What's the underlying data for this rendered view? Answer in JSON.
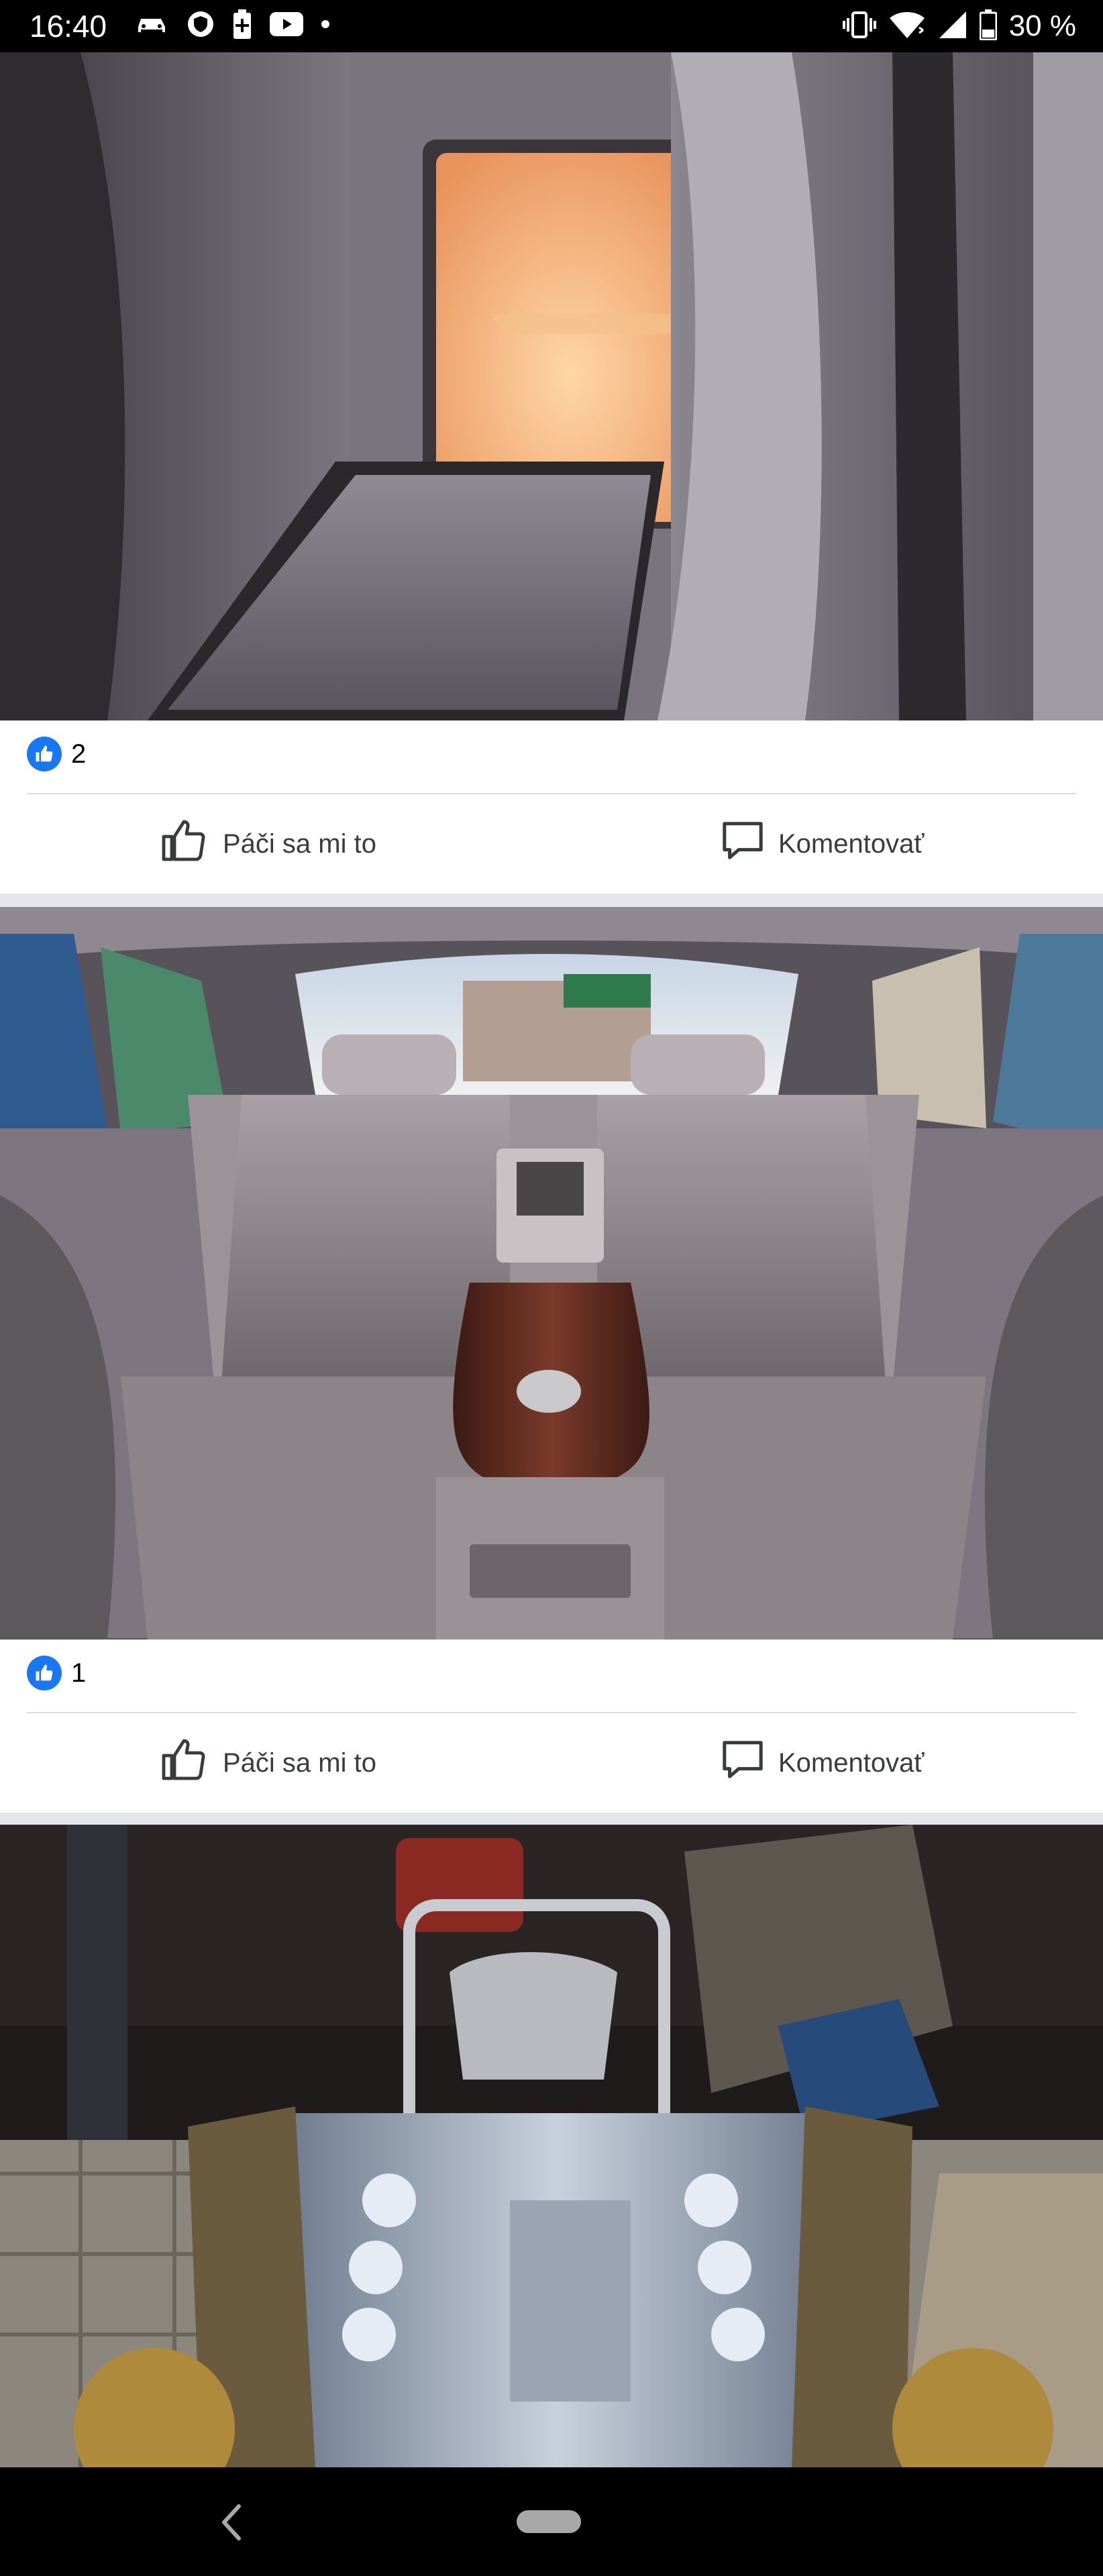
{
  "status_bar": {
    "time": "16:40",
    "notification_icons": [
      "car-icon",
      "shield-icon",
      "battery-saver-icon",
      "youtube-icon",
      "dot-icon"
    ],
    "system_icons": [
      "vibrate-icon",
      "wifi-icon",
      "signal-icon",
      "battery-icon"
    ],
    "battery_text": "30 %"
  },
  "posts": [
    {
      "photo": "rear armrest fridge open with warm light",
      "reaction_count": "2",
      "like_label": "Páči sa mi to",
      "comment_label": "Komentovať"
    },
    {
      "photo": "rear seats with center console",
      "reaction_count": "1",
      "like_label": "Páči sa mi to",
      "comment_label": "Komentovať"
    },
    {
      "photo": "engine block in garage"
    }
  ],
  "nav_bar": {
    "buttons": [
      "back-icon",
      "home-pill"
    ]
  }
}
